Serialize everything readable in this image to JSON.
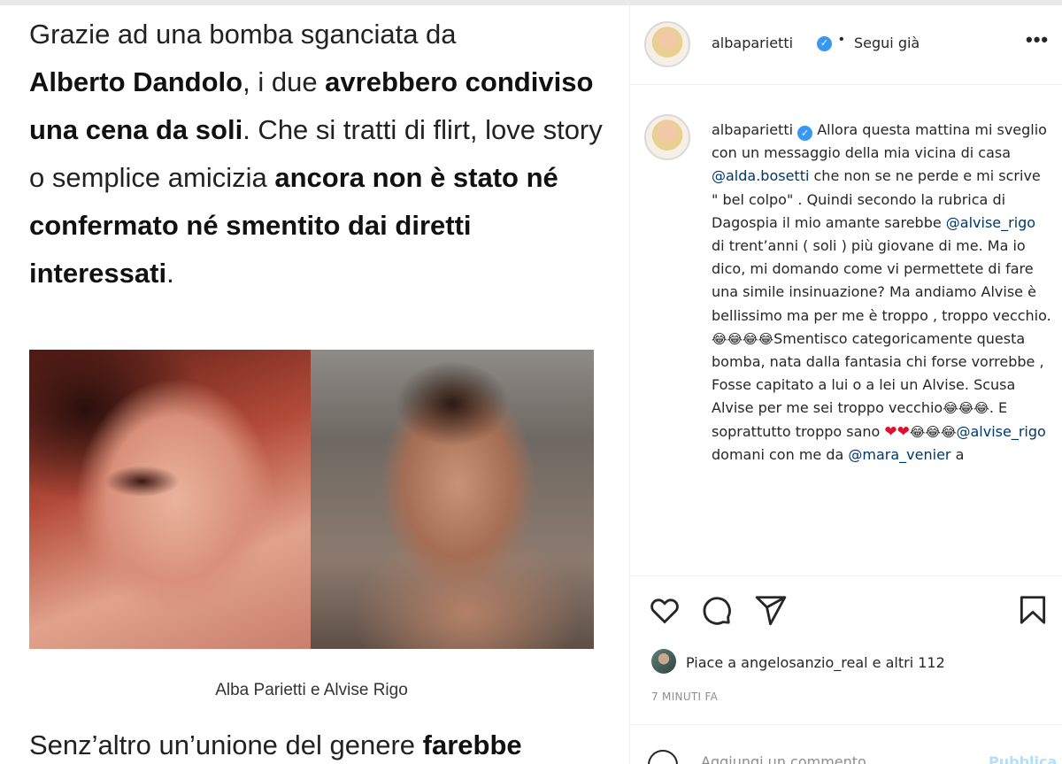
{
  "article": {
    "p1_seg1": "Grazie ad una bomba sganciata da",
    "p1_seg2": "Alberto Dandolo",
    "p1_seg3": ", i due ",
    "p1_seg4": "avrebbero condiviso una cena da soli",
    "p1_seg5": ". Che si tratti di flirt, love story o semplice amicizia ",
    "p1_seg6": "ancora non è stato né confermato né smentito dai diretti interessati",
    "p1_seg7": ".",
    "photo_caption": "Alba Parietti e Alvise Rigo",
    "p2_seg1": "Senz’altro un’unione del genere ",
    "p2_seg2": "farebbe"
  },
  "header": {
    "username": "albaparietti",
    "verified_mark": "✓",
    "separator": "•",
    "follow_label": "Segui già",
    "more_label": "•••"
  },
  "caption": {
    "username": "albaparietti",
    "t1": " Allora questa mattina mi sveglio con un messaggio della mia vicina di casa ",
    "m1": "@alda.bosetti",
    "t2": " che non se ne perde e mi scrive \" bel colpo\" . Quindi secondo la rubrica di Dagospia il mio amante sarebbe ",
    "m2": "@alvise_rigo",
    "t3": " di trent’anni ( soli ) più giovane di me. Ma io dico, mi domando come vi permettete di fare una simile insinuazione? Ma andiamo Alvise è bellissimo ma per me è troppo , troppo vecchio.",
    "e1": "😂😂😂😂",
    "t4": "Smentisco categoricamente questa bomba, nata dalla fantasia chi forse vorrebbe , Fosse capitato a lui o a lei un Alvise. Scusa Alvise per me sei troppo vecchio",
    "e2": "😂😂😂",
    "t5": ". E soprattutto troppo sano ",
    "e3": "❤❤",
    "e4": "😂😂😂",
    "m3": "@alvise_rigo",
    "t6": " domani con me da ",
    "m4": "@mara_venier",
    "t7": " a"
  },
  "actions": {
    "like": "heart-icon",
    "comment": "comment-icon",
    "share": "send-icon",
    "save": "bookmark-icon"
  },
  "likes": {
    "text": "Piace a angelosanzio_real e altri 112"
  },
  "time": {
    "ago": "7 MINUTI FA"
  },
  "add_comment": {
    "placeholder": "Aggiungi un commento...",
    "publish": "Pubblica"
  }
}
